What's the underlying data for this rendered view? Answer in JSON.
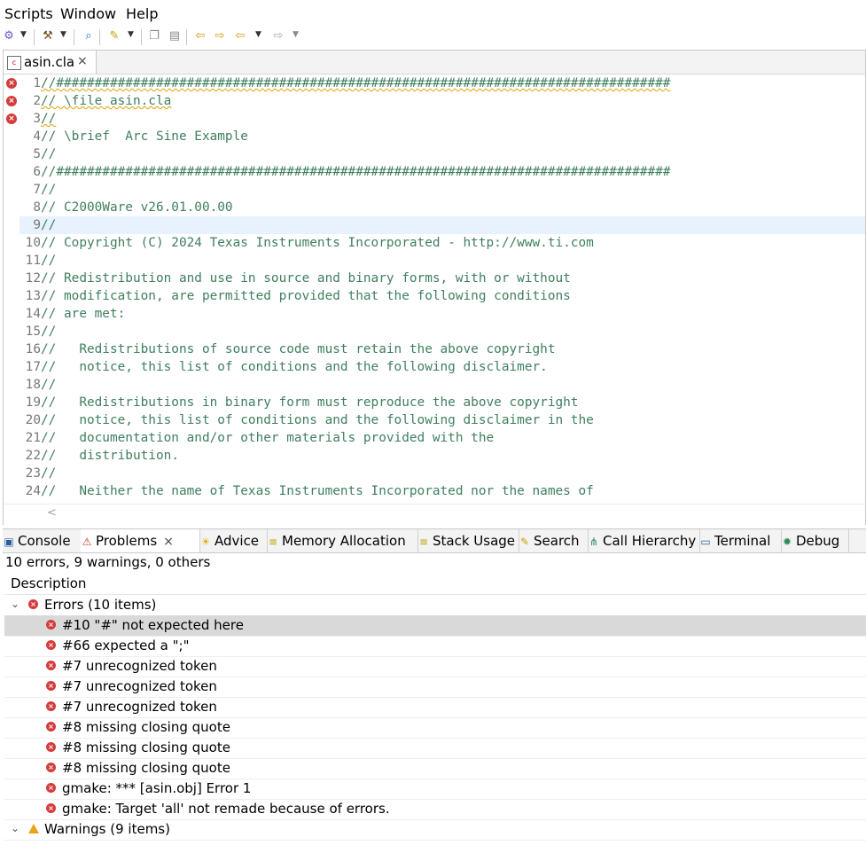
{
  "menu": [
    "Scripts",
    "Window",
    "Help"
  ],
  "toolbar_icons": [
    "debug-icon",
    "build-hammer-icon",
    "search-object-icon",
    "flash-icon",
    "copy-icon",
    "page-icon",
    "prev-edit-icon",
    "next-edit-icon",
    "back-icon",
    "forward-icon"
  ],
  "editor": {
    "tab_title": "asin.cla",
    "tab_close": "×",
    "lines": [
      {
        "n": "1",
        "text": "//################################################################################"
      },
      {
        "n": "2",
        "text": "// \\file asin.cla"
      },
      {
        "n": "3",
        "text": "//"
      },
      {
        "n": "4",
        "text": "// \\brief  Arc Sine Example"
      },
      {
        "n": "5",
        "text": "//"
      },
      {
        "n": "6",
        "text": "//################################################################################"
      },
      {
        "n": "7",
        "text": "//"
      },
      {
        "n": "8",
        "text": "// C2000Ware v26.01.00.00"
      },
      {
        "n": "9",
        "text": "//"
      },
      {
        "n": "10",
        "text": "// Copyright (C) 2024 Texas Instruments Incorporated - http://www.ti.com"
      },
      {
        "n": "11",
        "text": "//"
      },
      {
        "n": "12",
        "text": "// Redistribution and use in source and binary forms, with or without"
      },
      {
        "n": "13",
        "text": "// modification, are permitted provided that the following conditions"
      },
      {
        "n": "14",
        "text": "// are met:"
      },
      {
        "n": "15",
        "text": "//"
      },
      {
        "n": "16",
        "text": "//   Redistributions of source code must retain the above copyright"
      },
      {
        "n": "17",
        "text": "//   notice, this list of conditions and the following disclaimer."
      },
      {
        "n": "18",
        "text": "//"
      },
      {
        "n": "19",
        "text": "//   Redistributions in binary form must reproduce the above copyright"
      },
      {
        "n": "20",
        "text": "//   notice, this list of conditions and the following disclaimer in the"
      },
      {
        "n": "21",
        "text": "//   documentation and/or other materials provided with the"
      },
      {
        "n": "22",
        "text": "//   distribution."
      },
      {
        "n": "23",
        "text": "//"
      },
      {
        "n": "24",
        "text": "//   Neither the name of Texas Instruments Incorporated nor the names of"
      }
    ],
    "error_marker_lines": [
      "1",
      "2",
      "3"
    ],
    "current_line": "9"
  },
  "bottom_tabs": [
    {
      "label": "Console",
      "icon": "console-icon"
    },
    {
      "label": "Problems",
      "icon": "problems-icon",
      "active": true,
      "close": "×"
    },
    {
      "label": "Advice",
      "icon": "lightbulb-icon"
    },
    {
      "label": "Memory Allocation",
      "icon": "memory-icon"
    },
    {
      "label": "Stack Usage",
      "icon": "stack-icon"
    },
    {
      "label": "Search",
      "icon": "search-flashlight-icon"
    },
    {
      "label": "Call Hierarchy",
      "icon": "call-hierarchy-icon"
    },
    {
      "label": "Terminal",
      "icon": "terminal-icon"
    },
    {
      "label": "Debug",
      "icon": "debug-bug-icon"
    }
  ],
  "problems": {
    "summary": "10 errors, 9 warnings, 0 others",
    "column_header": "Description",
    "errors_group": "Errors (10 items)",
    "errors": [
      "#10 \"#\" not expected here",
      "#66 expected a \";\"",
      "#7 unrecognized token",
      "#7 unrecognized token",
      "#7 unrecognized token",
      "#8 missing closing quote",
      "#8 missing closing quote",
      "#8 missing closing quote",
      "gmake: *** [asin.obj] Error 1",
      "gmake: Target 'all' not remade because of errors."
    ],
    "selected_error_index": 0,
    "warnings_group": "Warnings (9 items)"
  },
  "colors": {
    "comment": "#3f7f5f",
    "error": "#d43b3b",
    "warning": "#e8a317",
    "current_line": "#e8f2fe",
    "selection": "#d9d9d9"
  }
}
